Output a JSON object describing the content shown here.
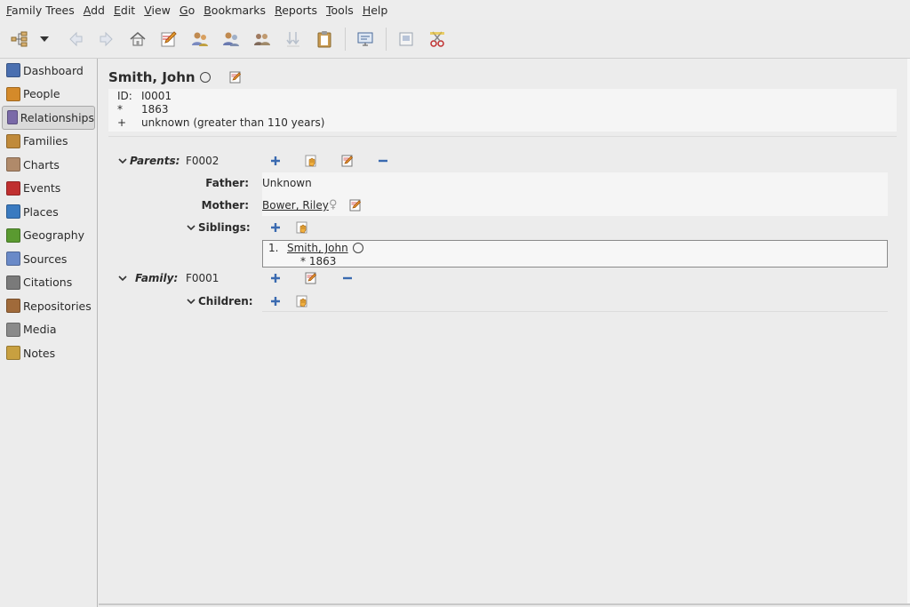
{
  "menubar": {
    "items": [
      {
        "label": "Family Trees",
        "u": "F",
        "rest": "amily Trees"
      },
      {
        "label": "Add",
        "u": "A",
        "rest": "dd"
      },
      {
        "label": "Edit",
        "u": "E",
        "rest": "dit"
      },
      {
        "label": "View",
        "u": "V",
        "rest": "iew"
      },
      {
        "label": "Go",
        "u": "G",
        "rest": "o"
      },
      {
        "label": "Bookmarks",
        "u": "B",
        "rest": "ookmarks"
      },
      {
        "label": "Reports",
        "u": "R",
        "rest": "eports"
      },
      {
        "label": "Tools",
        "u": "T",
        "rest": "ools"
      },
      {
        "label": "Help",
        "u": "H",
        "rest": "elp"
      }
    ]
  },
  "toolbar": {
    "buttons": [
      "tree-view-icon",
      "back-icon",
      "forward-icon",
      "home-icon",
      "edit-icon",
      "add-parents-icon",
      "share-parents-icon",
      "add-family-icon",
      "reorder-icon",
      "clipboard-icon",
      "config-view-icon",
      "media-icon",
      "tools-icon"
    ]
  },
  "sidebar": {
    "items": [
      {
        "label": "Dashboard",
        "icon": "dashboard-icon",
        "color": "#4a6fb0"
      },
      {
        "label": "People",
        "icon": "people-icon",
        "color": "#d48a2a"
      },
      {
        "label": "Relationships",
        "icon": "relationships-icon",
        "color": "#7a6aa8",
        "active": true
      },
      {
        "label": "Families",
        "icon": "families-icon",
        "color": "#c08a3a"
      },
      {
        "label": "Charts",
        "icon": "charts-icon",
        "color": "#b08a6a"
      },
      {
        "label": "Events",
        "icon": "events-icon",
        "color": "#c03030"
      },
      {
        "label": "Places",
        "icon": "places-icon",
        "color": "#3a7ac0"
      },
      {
        "label": "Geography",
        "icon": "geography-icon",
        "color": "#5a9a30"
      },
      {
        "label": "Sources",
        "icon": "sources-icon",
        "color": "#6a8ac8"
      },
      {
        "label": "Citations",
        "icon": "citations-icon",
        "color": "#7a7a7a"
      },
      {
        "label": "Repositories",
        "icon": "repositories-icon",
        "color": "#a06a3a"
      },
      {
        "label": "Media",
        "icon": "media-icon",
        "color": "#8a8a8a"
      },
      {
        "label": "Notes",
        "icon": "notes-icon",
        "color": "#c8a040"
      }
    ]
  },
  "person": {
    "name": "Smith, John",
    "id_key": "ID:",
    "id_value": "I0001",
    "birth_key": "*",
    "birth_value": "1863",
    "death_key": "+",
    "death_value": "unknown (greater than 110 years)"
  },
  "parents": {
    "label": "Parents:",
    "family_id": "F0002",
    "father_label": "Father:",
    "father_value": "Unknown",
    "mother_label": "Mother:",
    "mother_value": "Bower, Riley",
    "mother_gender": "♀",
    "siblings_label": "Siblings:",
    "siblings": [
      {
        "num": "1.",
        "name": "Smith, John",
        "birth": "* 1863"
      }
    ]
  },
  "family": {
    "label": "Family:",
    "family_id": "F0001",
    "children_label": "Children:"
  }
}
